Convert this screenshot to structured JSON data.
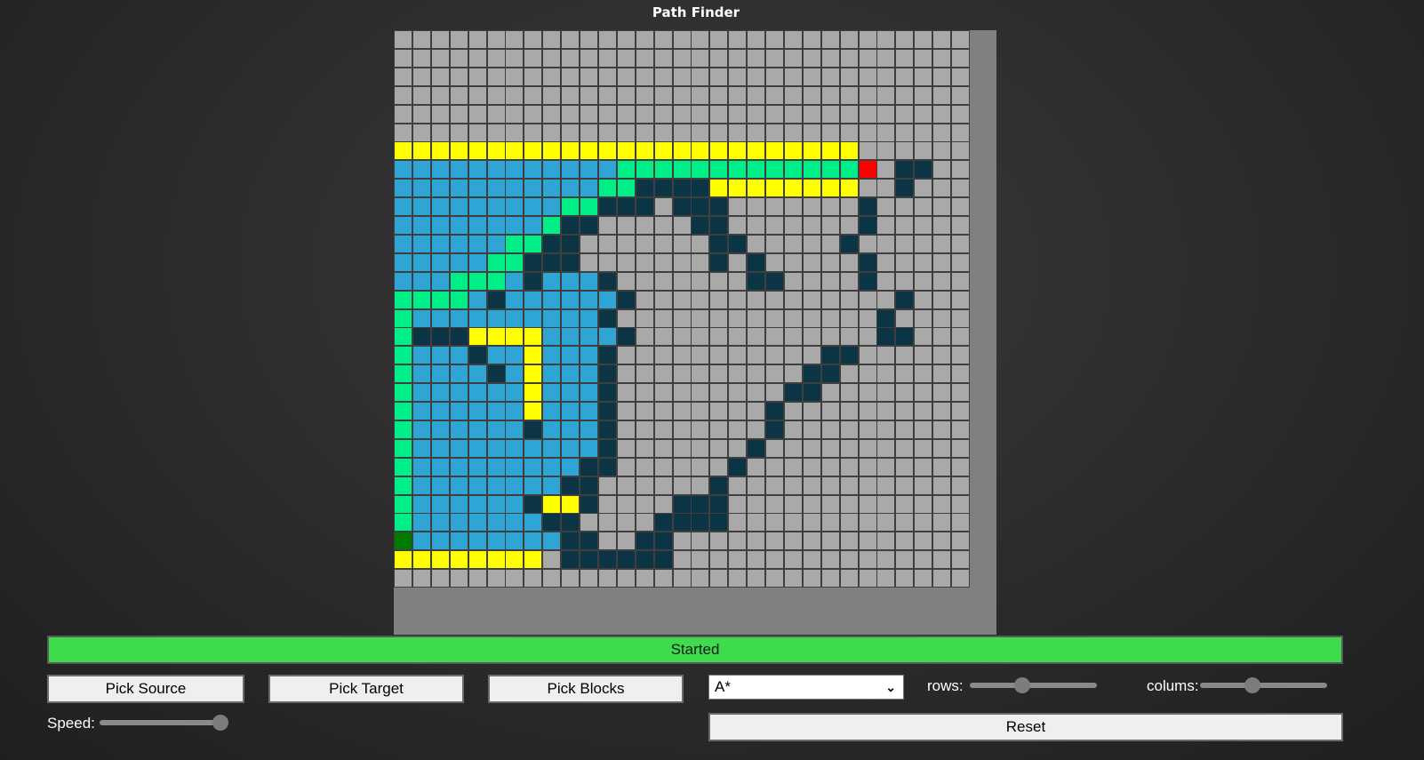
{
  "app": {
    "title": "Path Finder"
  },
  "status": {
    "text": "Started"
  },
  "controls": {
    "pick_source": "Pick Source",
    "pick_target": "Pick Target",
    "pick_blocks": "Pick Blocks",
    "reset": "Reset",
    "algorithm": {
      "selected": "A*"
    },
    "rows_label": "rows:",
    "cols_label": "colums:",
    "speed_label": "Speed:",
    "rows_value": 0.4,
    "cols_value": 0.4,
    "speed_value": 1.0
  },
  "colors": {
    "empty": "#a9a9a9",
    "path": "#ffff00",
    "visited": "#2ea5d5",
    "frontier": "#00ee88",
    "block": "#0b3444",
    "source": "#007b00",
    "target": "#ff0000",
    "status_bg": "#3ddc4e"
  },
  "grid": {
    "rows": [
      "..............................",
      "..............................",
      "..............................",
      "..............................",
      "..............................",
      "..............................",
      "PPPPPPPPPPPPPPPPPPPPPPPPP.....",
      "VVVVVVVVVVVVFFFFFFFFFFFFFT.BB.",
      "VVVVVVVVVVVFFBBBBPPPPPPPP..B..",
      "VVVVVVVVVFFBBB.BBB.......B..",
      "VVVVVVVVFBB.....BB.......B..",
      "VVVVVVFFBB.......BB.....B...",
      "VVVVVFFBBB.......B.B.....B...",
      "VVVFFFVBVVVB.......BB....B...",
      "FFFFVBVVVVVVB..............B....",
      "FVVVVVVVVVVB..............B.....",
      "FBBBPPPPVVVVB.............BB.....",
      "FVVVBVVPVVVB...........BB......",
      "FVVVVBVPVVVB..........BB.......",
      "FVVVVVVPVVVB.........BB........",
      "FVVVVVVPVVVB........B..........",
      "FVVVVVVBVVVB........B..........",
      "FVVVVVVVVVVB.......B...........",
      "FVVVVVVVVVBB......B............",
      "FVVVVVVVVBB......B.............",
      "FVVVVVVBPPB....BBB.............",
      "FVVVVVVVBB....BBBB.............",
      "SVVVVVVVVBB..BB................",
      "PPPPPPPP.BBBBBB................",
      ".............................."
    ]
  }
}
